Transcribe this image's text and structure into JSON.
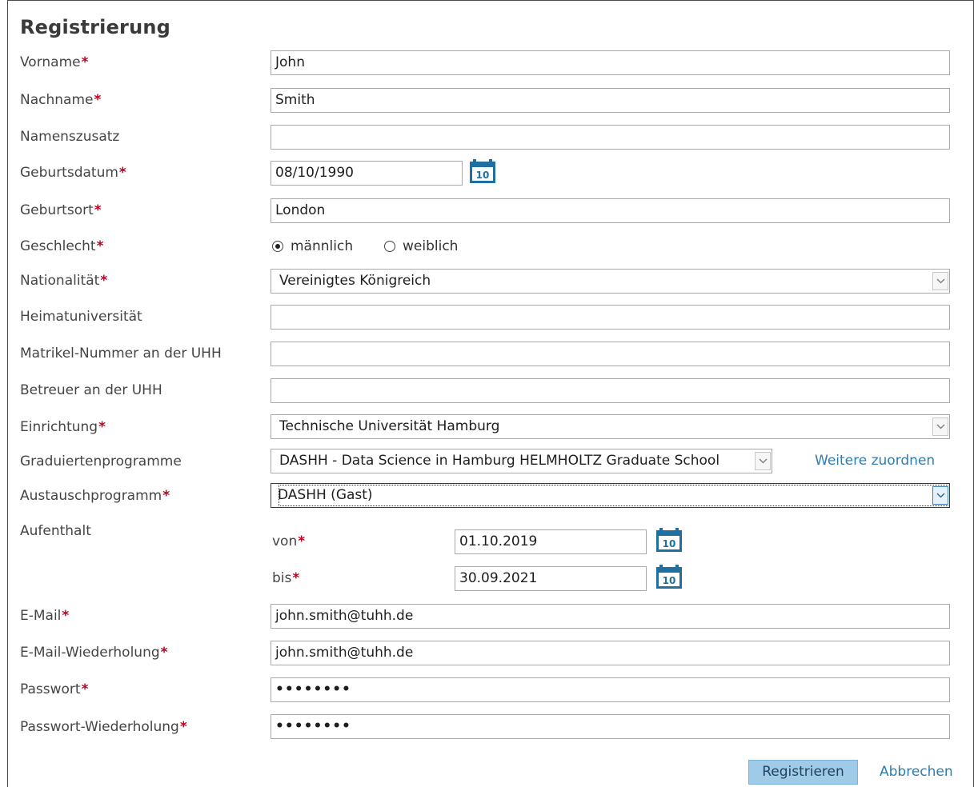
{
  "form": {
    "title": "Registrierung",
    "required_marker": "*",
    "fields": {
      "vorname": {
        "label": "Vorname",
        "value": "John"
      },
      "nachname": {
        "label": "Nachname",
        "value": "Smith"
      },
      "namenszusatz": {
        "label": "Namenszusatz",
        "value": ""
      },
      "geburtsdatum": {
        "label": "Geburtsdatum",
        "value": "08/10/1990"
      },
      "geburtsort": {
        "label": "Geburtsort",
        "value": "London"
      },
      "geschlecht": {
        "label": "Geschlecht",
        "options": [
          "männlich",
          "weiblich"
        ],
        "selected": "männlich"
      },
      "nationalitaet": {
        "label": "Nationalität",
        "value": "Vereinigtes Königreich"
      },
      "heimatuniversitaet": {
        "label": "Heimatuniversität",
        "value": ""
      },
      "matrikel": {
        "label": "Matrikel-Nummer an der UHH",
        "value": ""
      },
      "betreuer": {
        "label": "Betreuer an der UHH",
        "value": ""
      },
      "einrichtung": {
        "label": "Einrichtung",
        "value": "Technische Universität Hamburg"
      },
      "graduiertenprogramme": {
        "label": "Graduiertenprogramme",
        "value": "DASHH - Data Science in Hamburg HELMHOLTZ Graduate School",
        "link": "Weitere zuordnen"
      },
      "austauschprogramm": {
        "label": "Austauschprogramm",
        "value": "DASHH (Gast)"
      },
      "aufenthalt": {
        "label": "Aufenthalt",
        "von_label": "von",
        "von_value": "01.10.2019",
        "bis_label": "bis",
        "bis_value": "30.09.2021"
      },
      "email": {
        "label": "E-Mail",
        "value": "john.smith@tuhh.de"
      },
      "email_repeat": {
        "label": "E-Mail-Wiederholung",
        "value": "john.smith@tuhh.de"
      },
      "passwort": {
        "label": "Passwort",
        "value": "••••••••"
      },
      "passwort_repeat": {
        "label": "Passwort-Wiederholung",
        "value": "••••••••"
      }
    },
    "actions": {
      "submit": "Registrieren",
      "cancel": "Abbrechen"
    }
  },
  "icons": {
    "calendar": "calendar-icon",
    "dropdown": "chevron-down-icon"
  },
  "colors": {
    "required": "#c1001f",
    "link": "#2d7db3",
    "button_bg": "#9fcbe8",
    "calendar": "#1f6fa0"
  }
}
